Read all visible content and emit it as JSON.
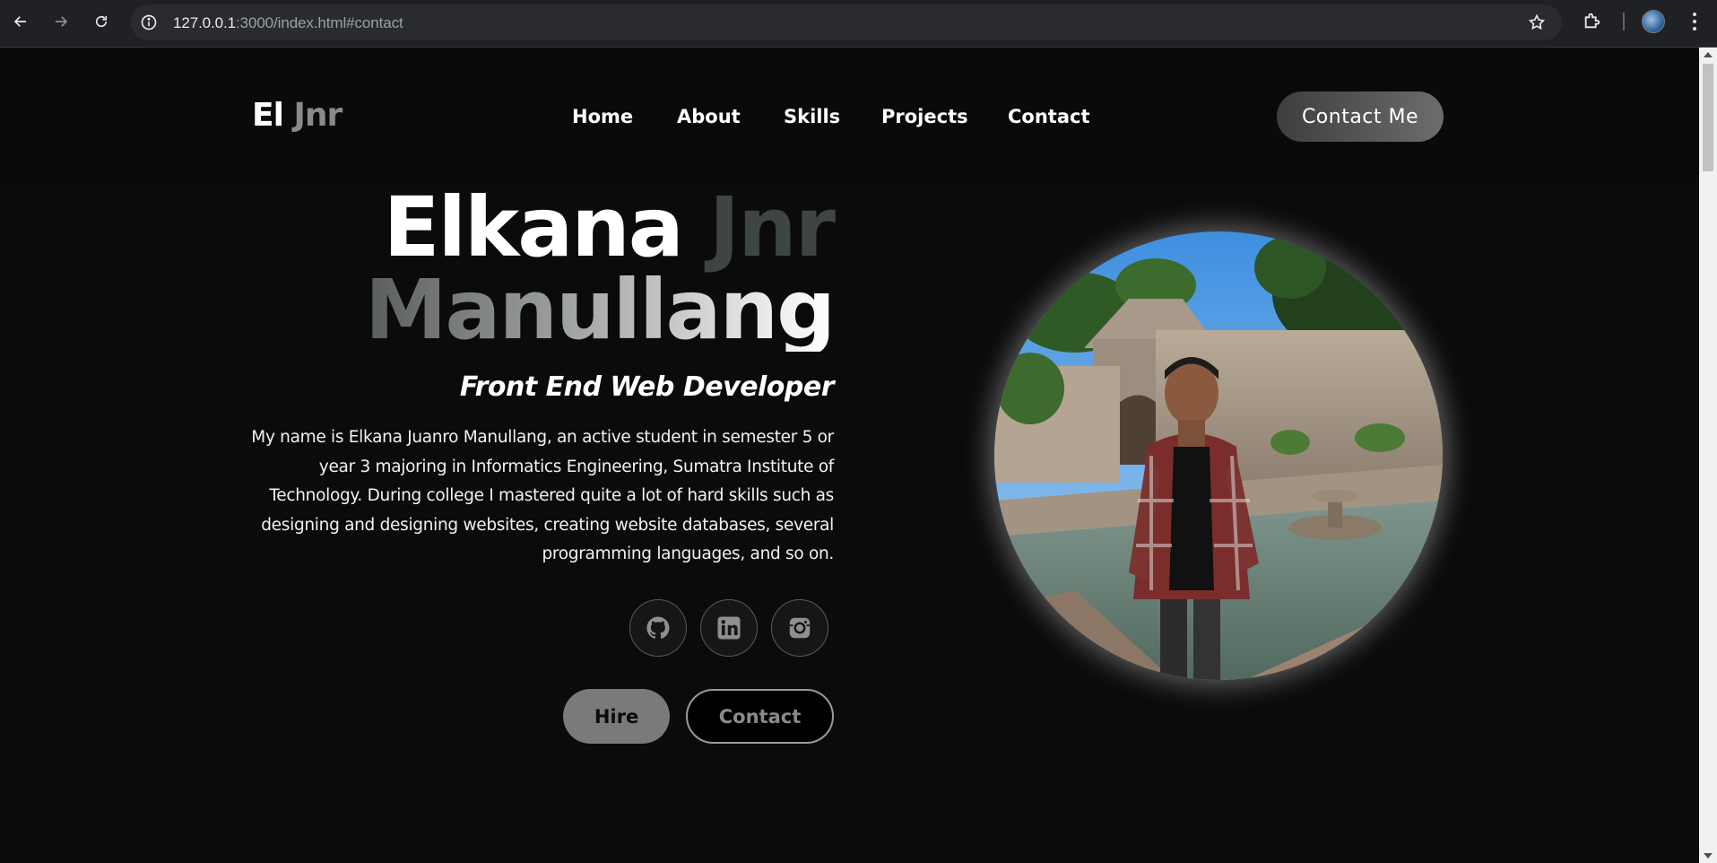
{
  "browser": {
    "url_host": "127.0.0.1",
    "url_rest": ":3000/index.html#contact"
  },
  "header": {
    "logo_main": "El",
    "logo_accent": "Jnr",
    "nav": [
      {
        "label": "Home"
      },
      {
        "label": "About"
      },
      {
        "label": "Skills"
      },
      {
        "label": "Projects"
      },
      {
        "label": "Contact"
      }
    ],
    "cta_label": "Contact Me"
  },
  "hero": {
    "first_name": "Elkana",
    "nickname": "Jnr",
    "last_name": "Manullang",
    "role": "Front End Web Developer",
    "bio": "My name is Elkana Juanro Manullang, an active student in semester 5 or year 3 majoring in Informatics Engineering, Sumatra Institute of Technology. During college I mastered quite a lot of hard skills such as designing and designing websites, creating website databases, several programming languages, and so on.",
    "socials": [
      {
        "icon": "github-icon"
      },
      {
        "icon": "linkedin-icon"
      },
      {
        "icon": "instagram-icon"
      }
    ],
    "hire_label": "Hire",
    "contact_label": "Contact"
  },
  "colors": {
    "background": "#0b0b0b",
    "accent_gray": "#7a7a7a",
    "text": "#ffffff"
  }
}
